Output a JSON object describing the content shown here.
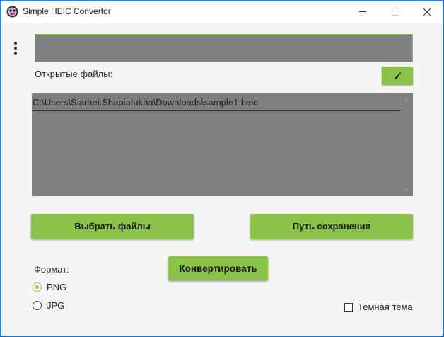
{
  "window": {
    "title": "Simple HEIC Convertor",
    "controls": {
      "minimize": "minimize-icon",
      "maximize": "maximize-icon",
      "close": "close-icon"
    }
  },
  "toolbar": {
    "menu_icon": "kebab-menu-icon"
  },
  "save_path": {
    "value": "",
    "placeholder": ""
  },
  "files": {
    "label": "Открытые файлы:",
    "clear_icon": "broom-icon",
    "items": [
      "C:\\Users\\Siarhei.Shapiatukha\\Downloads\\sample1.heic"
    ]
  },
  "actions": {
    "select_files": "Выбрать файлы",
    "save_path": "Путь сохранения",
    "convert": "Конвертировать"
  },
  "format": {
    "label": "Формат:",
    "options": [
      {
        "label": "PNG",
        "selected": true
      },
      {
        "label": "JPG",
        "selected": false
      }
    ]
  },
  "theme": {
    "dark_label": "Темная тема",
    "dark_checked": false
  },
  "colors": {
    "accent": "#8bc34a",
    "field_bg": "#7f7f7f",
    "window_bg": "#f5f5f5"
  }
}
